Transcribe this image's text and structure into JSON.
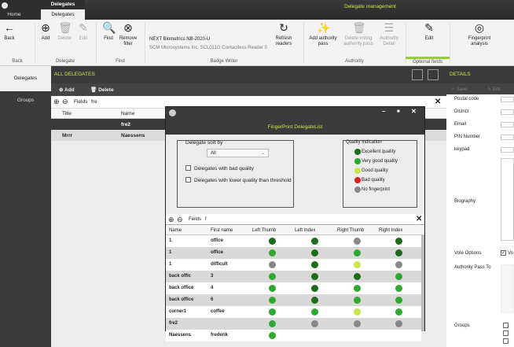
{
  "titlebar": {
    "context_tab": "Delegates",
    "title": "Delegate management"
  },
  "tabs": {
    "home": "Home",
    "delegates": "Delegates"
  },
  "ribbon": {
    "buttons": [
      {
        "label": "Back",
        "icon": "back-arrow-icon"
      },
      {
        "label": "Add",
        "icon": "add-icon"
      },
      {
        "label": "Delete",
        "icon": "trash-icon"
      },
      {
        "label": "Edit",
        "icon": "pencil-icon"
      },
      {
        "label": "Find",
        "icon": "search-icon"
      },
      {
        "label": "Remove\nfilter",
        "icon": "remove-filter-icon"
      },
      {
        "label": "Refresh\nreaders",
        "icon": "refresh-icon"
      },
      {
        "label": "Add authority\npass",
        "icon": "wand-icon"
      },
      {
        "label": "Delete voting\nauthority pass",
        "icon": "trash-icon"
      },
      {
        "label": "Authority\nDetail",
        "icon": "list-icon"
      },
      {
        "label": "Edit",
        "icon": "pencil-icon"
      },
      {
        "label": "Fingerprint\nanalysis",
        "icon": "fingerprint-icon"
      }
    ],
    "badge_writer_title": "NEXT Biometrics NB-2020-U",
    "badge_writer_reader": "SCM Microsystems Inc. SCL011G Contactless Reader 0",
    "groups": [
      "Back",
      "Delegate",
      "Find",
      "Badge Writer",
      "Authority",
      "Optional fields"
    ]
  },
  "nav": {
    "delegates": "Delegates",
    "groups": "Groups"
  },
  "main": {
    "header": "ALL DELEGATES",
    "add_label": "Add",
    "delete_label": "Delete",
    "fields_label": "Fields",
    "filter_value": "fre",
    "col_title": "Title",
    "col_name": "Name",
    "rows": [
      {
        "title": "",
        "name": "fre2"
      },
      {
        "title": "Mrrr",
        "name": "Naessens"
      }
    ]
  },
  "details": {
    "header": "DETAILS",
    "save": "Save",
    "edit": "Edit",
    "labels": [
      "Postal code",
      "District",
      "Email",
      "PIN Number",
      "keypad",
      "Biography",
      "Vote Options",
      "Authority Pass To",
      "Groups"
    ],
    "vote_option_text": "Vo"
  },
  "dialog": {
    "title": "FingerPrint DelegateList",
    "sort_by_label": "Delegate sort by",
    "sort_value": "All",
    "chk_bad": "Delegates with bad quality",
    "chk_lower": "Delegates with lower quality than threshold",
    "quality_label": "Quality indication",
    "quality": [
      {
        "label": "Excellent quality",
        "color": "#1e6b1e"
      },
      {
        "label": "Very good quality",
        "color": "#2ea82e"
      },
      {
        "label": "Good quality",
        "color": "#c8e84a"
      },
      {
        "label": "Bad quality",
        "color": "#e02020"
      },
      {
        "label": "No fingerprint",
        "color": "#888888"
      }
    ],
    "fields_label": "Fields",
    "filter_value": "f",
    "columns": [
      "Name",
      "First name",
      "Left Thumb",
      "Left Index",
      "Right Thumb",
      "Right Index"
    ],
    "rows": [
      {
        "name": "1",
        "first": "office",
        "q": [
          "excellent",
          "excellent",
          "none",
          "excellent"
        ]
      },
      {
        "name": "1",
        "first": "office",
        "q": [
          "verygood",
          "excellent",
          "verygood",
          "excellent"
        ]
      },
      {
        "name": "1",
        "first": "difficult",
        "q": [
          "none",
          "excellent",
          "good",
          "none"
        ]
      },
      {
        "name": "back offic",
        "first": "3",
        "q": [
          "verygood",
          "excellent",
          "excellent",
          "verygood"
        ]
      },
      {
        "name": "back office",
        "first": "4",
        "q": [
          "verygood",
          "excellent",
          "verygood",
          "verygood"
        ]
      },
      {
        "name": "back office",
        "first": "6",
        "q": [
          "verygood",
          "excellent",
          "verygood",
          "verygood"
        ]
      },
      {
        "name": "corner1",
        "first": "coffee",
        "q": [
          "verygood",
          "verygood",
          "good",
          "verygood"
        ]
      },
      {
        "name": "fre2",
        "first": "",
        "q": [
          "verygood",
          "none",
          "none",
          "none"
        ]
      },
      {
        "name": "Naessens",
        "first": "frederik",
        "q": [
          "verygood",
          "",
          "",
          ""
        ]
      }
    ]
  }
}
